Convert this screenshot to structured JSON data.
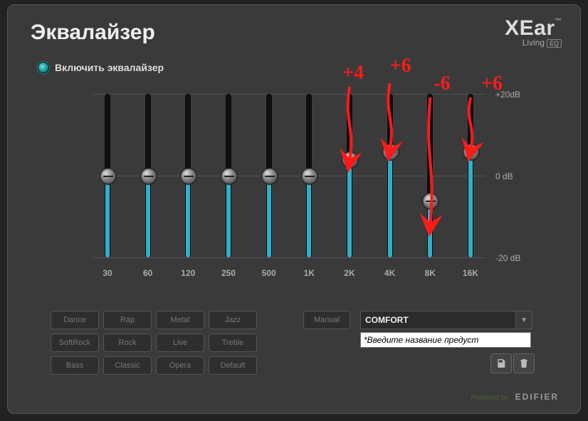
{
  "title": "Эквалайзер",
  "brand": {
    "name": "XEar",
    "tm": "™",
    "sub": "Living",
    "badge": "EQ"
  },
  "enable_label": "Включить эквалайзер",
  "scale": {
    "top": "+20dB",
    "mid": "0   dB",
    "bot": "-20 dB"
  },
  "chart_data": {
    "type": "bar",
    "categories": [
      "30",
      "60",
      "120",
      "250",
      "500",
      "1K",
      "2K",
      "4K",
      "8K",
      "16K"
    ],
    "values": [
      0,
      0,
      0,
      0,
      0,
      0,
      4,
      6,
      -6,
      6
    ],
    "ylabel": "dB",
    "ylim": [
      -20,
      20
    ]
  },
  "presets": {
    "row1": [
      "Dance",
      "Rap",
      "Metal",
      "Jazz"
    ],
    "row2": [
      "SoftRock",
      "Rock",
      "Live",
      "Treble"
    ],
    "row3": [
      "Bass",
      "Classic",
      "Opera",
      "Default"
    ]
  },
  "manual_label": "Manual",
  "select_value": "COMFORT",
  "input_hint": "*Введите название предуст",
  "footer": {
    "powered": "Powered by",
    "brand": "EDIFIER"
  },
  "annotations": [
    {
      "text": "+4",
      "band": 6
    },
    {
      "text": "+6",
      "band": 7
    },
    {
      "text": "-6",
      "band": 8
    },
    {
      "text": "+6",
      "band": 9
    }
  ]
}
